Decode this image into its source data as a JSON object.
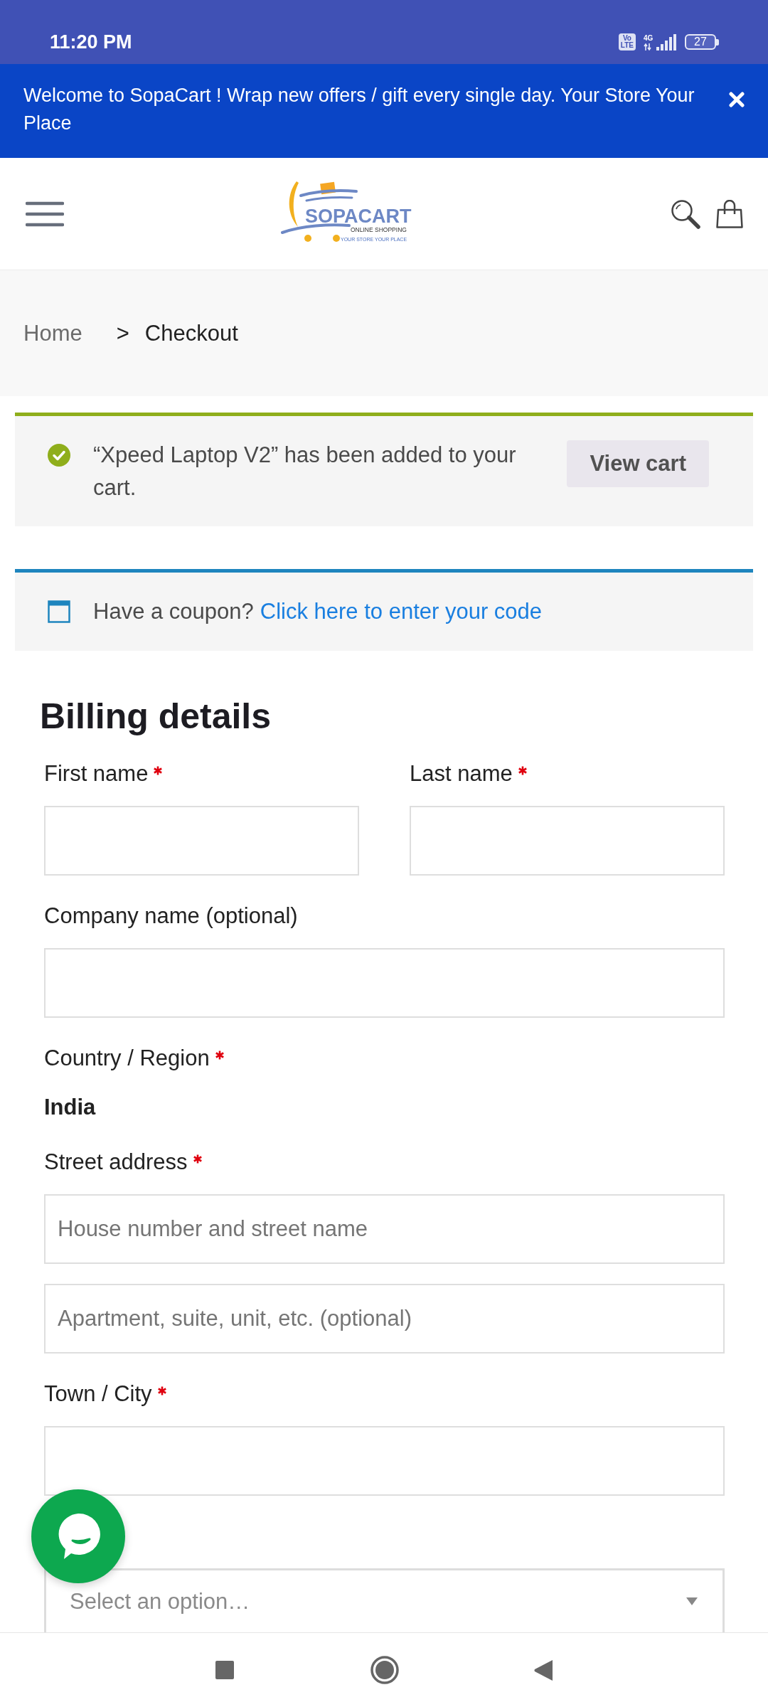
{
  "status_bar": {
    "time": "11:20 PM",
    "volte": [
      "Vo",
      "LTE"
    ],
    "network": "4G",
    "battery": "27"
  },
  "announcement": {
    "text": "Welcome to SopaCart ! Wrap new offers / gift every single day. Your Store Your Place"
  },
  "header": {
    "logo": {
      "name": "SOPACART",
      "tagline_top": "ONLINE SHOPPING",
      "tagline_bottom": "YOUR STORE YOUR PLACE"
    }
  },
  "breadcrumb": {
    "separator": ">",
    "items": [
      {
        "label": "Home",
        "current": false
      },
      {
        "label": "Checkout",
        "current": true
      }
    ]
  },
  "notices": [
    {
      "kind": "success",
      "text": "“Xpeed Laptop V2” has been added to your cart.",
      "button": "View cart"
    },
    {
      "kind": "info",
      "text": "Have a coupon?",
      "link": "Click here to enter your code"
    }
  ],
  "billing": {
    "title": "Billing details",
    "rows": [
      {
        "fields": [
          {
            "kind": "input",
            "label": "First name",
            "required": true
          },
          {
            "kind": "input",
            "label": "Last name",
            "required": true
          }
        ]
      },
      {
        "fields": [
          {
            "kind": "input",
            "label": "Company name (optional)",
            "required": false
          }
        ]
      },
      {
        "fields": [
          {
            "kind": "static",
            "label": "Country / Region",
            "required": true,
            "value": "India"
          }
        ]
      },
      {
        "fields": [
          {
            "kind": "input",
            "label": "Street address",
            "required": true,
            "placeholders": [
              "House number and street name",
              "Apartment, suite, unit, etc. (optional)"
            ]
          }
        ]
      },
      {
        "fields": [
          {
            "kind": "input",
            "label": "Town / City",
            "required": true
          }
        ]
      },
      {
        "fields": [
          {
            "kind": "select",
            "placeholder": "Select an option…"
          }
        ]
      }
    ]
  }
}
